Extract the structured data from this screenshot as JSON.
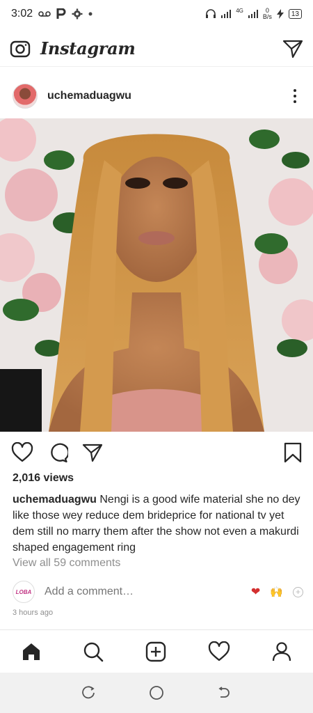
{
  "status_bar": {
    "time": "3:02",
    "net_badge": "4G",
    "speed_top": "0",
    "speed_unit": "B/s",
    "battery": "13"
  },
  "app": {
    "title": "Instagram"
  },
  "post": {
    "username": "uchemaduagwu",
    "views": "2,016 views",
    "caption_user": "uchemaduagwu",
    "caption_text": "Nengi is a good wife material she no dey like those wey reduce dem brideprice for national tv yet dem still no marry them after the show not even a makurdi shaped engagement ring",
    "view_comments": "View all 59 comments",
    "comment_placeholder": "Add a comment…",
    "commenter_avatar_text": "LOBA",
    "quick_heart": "❤",
    "quick_hands": "🙌",
    "quick_plus": "+",
    "timestamp": "3 hours ago"
  },
  "icons": {
    "camera": "camera-icon",
    "direct": "send-icon",
    "more": "more-vertical-icon",
    "like": "heart-outline-icon",
    "comment": "comment-icon",
    "share": "share-icon",
    "save": "bookmark-icon",
    "home": "home-icon",
    "search": "search-icon",
    "new_post": "add-post-icon",
    "activity": "heart-outline-icon",
    "profile": "profile-icon"
  },
  "colors": {
    "text": "#262626",
    "muted": "#8e8e8e",
    "heart_red": "#d32f2f"
  }
}
